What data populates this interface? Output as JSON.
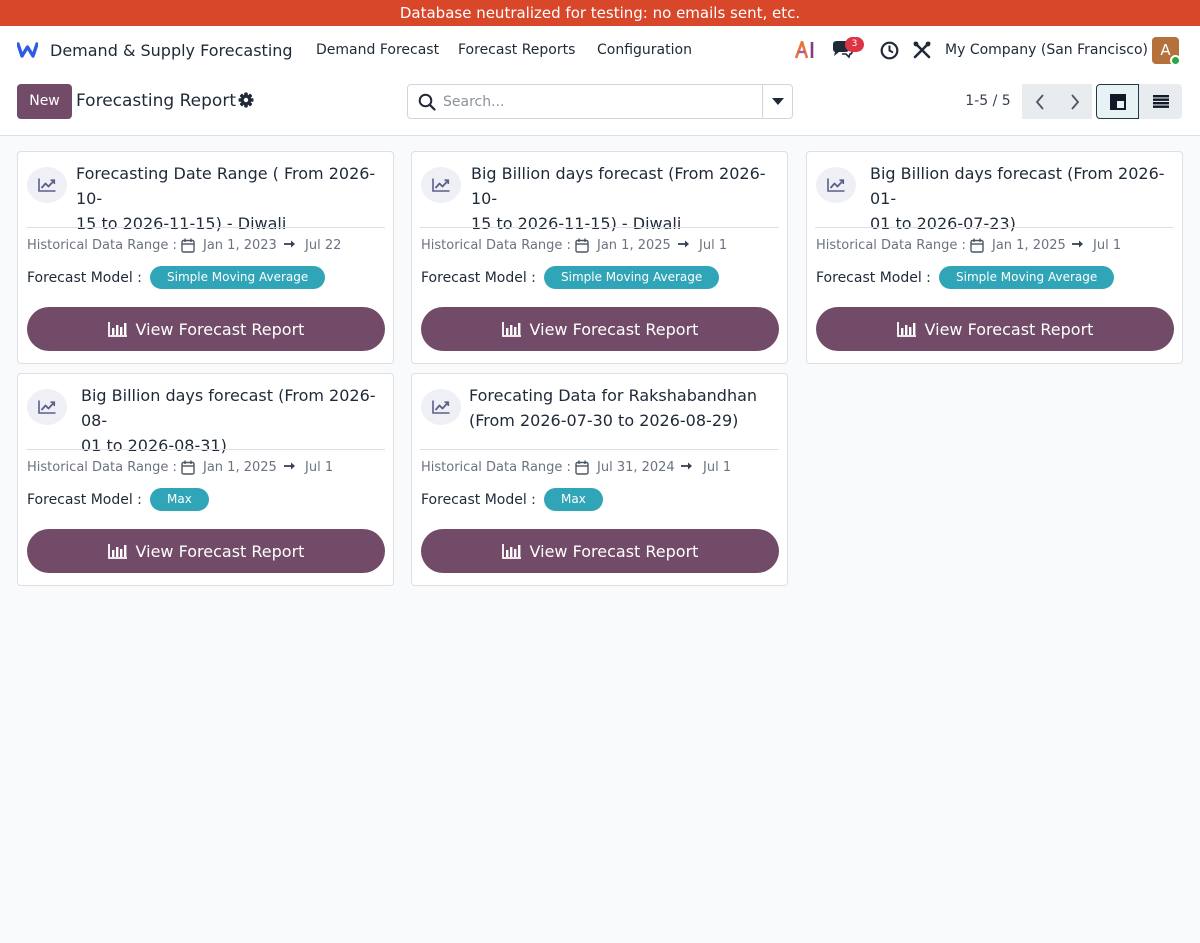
{
  "banner": {
    "text": "Database neutralized for testing: no emails sent, etc."
  },
  "navbar": {
    "app_name": "Demand & Supply Forecasting",
    "menu": [
      "Demand Forecast",
      "Forecast Reports",
      "Configuration"
    ],
    "messages_count": "3",
    "company": "My Company (San Francisco)",
    "avatar_letter": "A"
  },
  "control": {
    "new_label": "New",
    "title": "Forecasting Report",
    "search_placeholder": "Search...",
    "pager": "1-5 / 5"
  },
  "cards": [
    {
      "title_line1": "Forecasting Date Range ( From 2026-10-",
      "title_line2": "15 to 2026-11-15) - Diwali",
      "hist_label": "Historical Data Range :",
      "start": "Jan 1, 2023",
      "end": "Jul 22",
      "model_label": "Forecast Model :",
      "model": "Simple Moving Average",
      "button": "View Forecast Report"
    },
    {
      "title_line1": "Big Billion days forecast (From 2026-10-",
      "title_line2": "15 to 2026-11-15) - Diwali",
      "hist_label": "Historical Data Range :",
      "start": "Jan 1, 2025",
      "end": "Jul 1",
      "model_label": "Forecast Model :",
      "model": "Simple Moving Average",
      "button": "View Forecast Report"
    },
    {
      "title_line1": "Big Billion days forecast (From 2026-01-",
      "title_line2": "01 to 2026-07-23)",
      "hist_label": "Historical Data Range :",
      "start": "Jan 1, 2025",
      "end": "Jul 1",
      "model_label": "Forecast Model :",
      "model": "Simple Moving Average",
      "button": "View Forecast Report"
    },
    {
      "title_line1": "Big Billion days forecast (From 2026-08-",
      "title_line2": "01 to 2026-08-31)",
      "hist_label": "Historical Data Range :",
      "start": "Jan 1, 2025",
      "end": "Jul 1",
      "model_label": "Forecast Model :",
      "model": "Max",
      "button": "View Forecast Report"
    },
    {
      "title_line1": "Forecating Data for Rakshabandhan",
      "title_line2": "(From 2026-07-30 to 2026-08-29)",
      "hist_label": "Historical Data Range :",
      "start": "Jul 31, 2024",
      "end": "Jul 1",
      "model_label": "Forecast Model :",
      "model": "Max",
      "button": "View Forecast Report"
    }
  ],
  "colors": {
    "primary": "#714b67",
    "banner": "#d9472b",
    "badge_teal": "#31a5b8",
    "notification": "#dc3545"
  },
  "icons": [
    "app-logo-icon",
    "ai-icon",
    "chat-icon",
    "clock-icon",
    "tools-icon",
    "gear-icon",
    "search-icon",
    "caret-down-icon",
    "chevron-left-icon",
    "chevron-right-icon",
    "kanban-view-icon",
    "list-view-icon",
    "trend-chart-icon",
    "calendar-icon",
    "arrow-right-icon",
    "bar-chart-icon"
  ]
}
